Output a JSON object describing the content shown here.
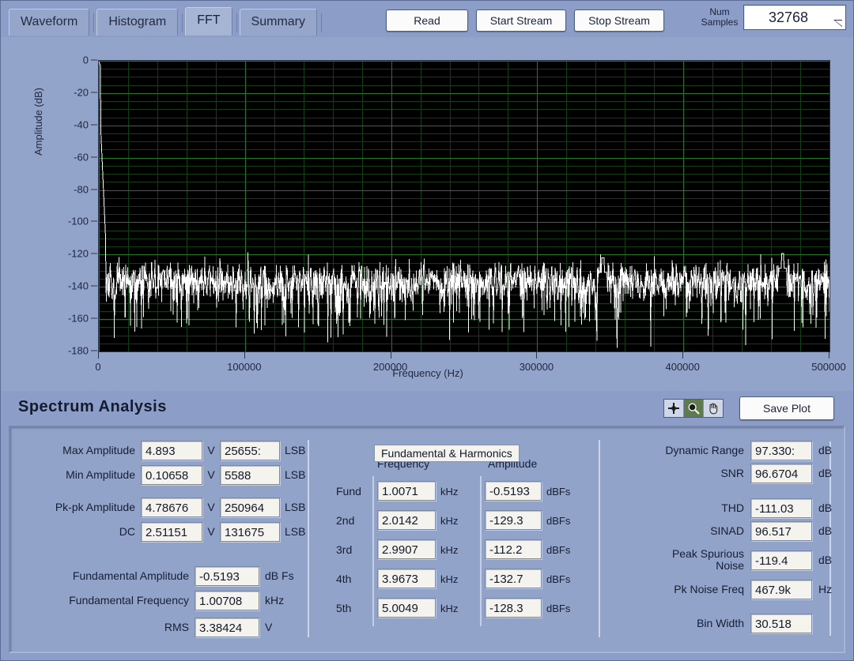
{
  "tabs": [
    {
      "label": "Waveform",
      "active": false
    },
    {
      "label": "Histogram",
      "active": false
    },
    {
      "label": "FFT",
      "active": true
    },
    {
      "label": "Summary",
      "active": false
    }
  ],
  "toolbar": {
    "read_label": "Read",
    "start_stream_label": "Start Stream",
    "stop_stream_label": "Stop Stream",
    "num_samples_label": "Num\nSamples",
    "num_samples_label_line1": "Num",
    "num_samples_label_line2": "Samples",
    "num_samples_value": "32768"
  },
  "section": {
    "title": "Spectrum Analysis",
    "save_plot_label": "Save Plot",
    "palette": [
      {
        "name": "cursor-crosshair-tool",
        "selected": false
      },
      {
        "name": "zoom-tool",
        "selected": true
      },
      {
        "name": "pan-hand-tool",
        "selected": false
      }
    ]
  },
  "chart_data": {
    "type": "line",
    "title": "",
    "xlabel": "Frequency (Hz)",
    "ylabel": "Amplitude (dB)",
    "xlim": [
      0,
      500000
    ],
    "ylim": [
      -180,
      0
    ],
    "xticks": [
      0,
      100000,
      200000,
      300000,
      400000,
      500000
    ],
    "xtick_labels": [
      "0",
      "100000",
      "200000",
      "300000",
      "400000",
      "500000"
    ],
    "yticks": [
      0,
      -20,
      -40,
      -60,
      -80,
      -100,
      -120,
      -140,
      -160,
      -180
    ],
    "ytick_labels": [
      "0",
      "-20",
      "-40",
      "-60",
      "-80",
      "-100",
      "-120",
      "-140",
      "-160",
      "-180"
    ],
    "grid": true,
    "grid_color": "#1d5c1d",
    "plot_bg": "#000000",
    "trace_color": "#ffffff",
    "legend": null,
    "description": "FFT magnitude spectrum: fundamental spike at ~1 kHz reaching about -0.5 dBFS at the far left, noise floor around -130 to -145 dB with peaks down to about -170 dB, spurious tones near 345 kHz and 468 kHz.",
    "fundamental_hz": 1007,
    "fundamental_db": -0.5193,
    "noise_floor_db": -137,
    "spurs": [
      {
        "freq_hz": 345000,
        "amplitude_db": -122
      },
      {
        "freq_hz": 467900,
        "amplitude_db": -119.4
      }
    ]
  },
  "left_panel": {
    "rows": [
      {
        "label": "Max Amplitude",
        "volts": "4.893",
        "volt_unit": "V",
        "lsb": "25655:",
        "lsb_unit": "LSB"
      },
      {
        "label": "Min Amplitude",
        "volts": "0.10658",
        "volt_unit": "V",
        "lsb": "5588",
        "lsb_unit": "LSB"
      },
      {
        "label": "Pk-pk Amplitude",
        "volts": "4.78676",
        "volt_unit": "V",
        "lsb": "250964",
        "lsb_unit": "LSB"
      },
      {
        "label": "DC",
        "volts": "2.51151",
        "volt_unit": "V",
        "lsb": "131675",
        "lsb_unit": "LSB"
      }
    ],
    "summary_rows": [
      {
        "label": "Fundamental Amplitude",
        "value": "-0.5193",
        "unit": "dB Fs"
      },
      {
        "label": "Fundamental Frequency",
        "value": "1.00708",
        "unit": "kHz"
      },
      {
        "label": "RMS",
        "value": "3.38424",
        "unit": "V"
      }
    ]
  },
  "harmonics": {
    "title": "Fundamental & Harmonics",
    "col_freq": "Frequency",
    "col_amp": "Amplitude",
    "freq_unit": "kHz",
    "amp_unit": "dBFs",
    "rows": [
      {
        "name": "Fund",
        "frequency": "1.0071",
        "amplitude": "-0.5193"
      },
      {
        "name": "2nd",
        "frequency": "2.0142",
        "amplitude": "-129.3"
      },
      {
        "name": "3rd",
        "frequency": "2.9907",
        "amplitude": "-112.2"
      },
      {
        "name": "4th",
        "frequency": "3.9673",
        "amplitude": "-132.7"
      },
      {
        "name": "5th",
        "frequency": "5.0049",
        "amplitude": "-128.3"
      }
    ]
  },
  "right_panel": {
    "rows": [
      {
        "label": "Dynamic Range",
        "value": "97.330:",
        "unit": "dB"
      },
      {
        "label": "SNR",
        "value": "96.6704",
        "unit": "dB"
      },
      {
        "label": "THD",
        "value": "-111.03",
        "unit": "dB"
      },
      {
        "label": "SINAD",
        "value": "96.517",
        "unit": "dB"
      },
      {
        "label": "Peak Spurious\nNoise",
        "label_line1": "Peak Spurious",
        "label_line2": "Noise",
        "value": "-119.4",
        "unit": "dB"
      },
      {
        "label": "Pk Noise Freq",
        "value": "467.9k",
        "unit": "Hz"
      },
      {
        "label": "Bin Width",
        "value": "30.518",
        "unit": ""
      }
    ]
  }
}
